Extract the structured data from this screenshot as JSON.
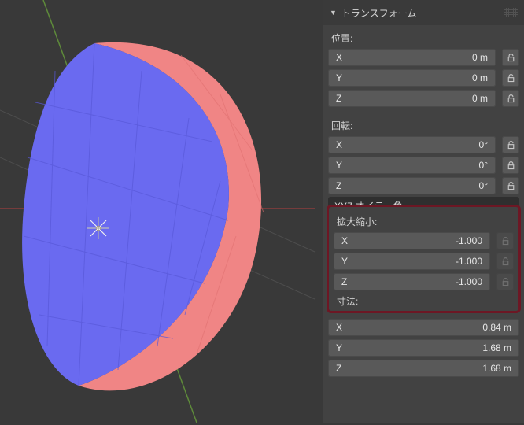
{
  "panel": {
    "title": "トランスフォーム"
  },
  "location": {
    "label": "位置:",
    "x_axis": "X",
    "x_value": "0 m",
    "y_axis": "Y",
    "y_value": "0 m",
    "z_axis": "Z",
    "z_value": "0 m"
  },
  "rotation": {
    "label": "回転:",
    "x_axis": "X",
    "x_value": "0°",
    "y_axis": "Y",
    "y_value": "0°",
    "z_axis": "Z",
    "z_value": "0°",
    "mode": "XYZ オイラー角"
  },
  "scale": {
    "label": "拡大縮小:",
    "x_axis": "X",
    "x_value": "-1.000",
    "y_axis": "Y",
    "y_value": "-1.000",
    "z_axis": "Z",
    "z_value": "-1.000"
  },
  "dimensions": {
    "label": "寸法:",
    "x_axis": "X",
    "x_value": "0.84 m",
    "y_axis": "Y",
    "y_value": "1.68 m",
    "z_axis": "Z",
    "z_value": "1.68 m"
  },
  "colors": {
    "face_front": "#6a6af0",
    "face_back": "#f08585",
    "axis_x": "#b44a4a",
    "axis_y": "#7fb24d",
    "axis_z": "#5a7fd6"
  }
}
